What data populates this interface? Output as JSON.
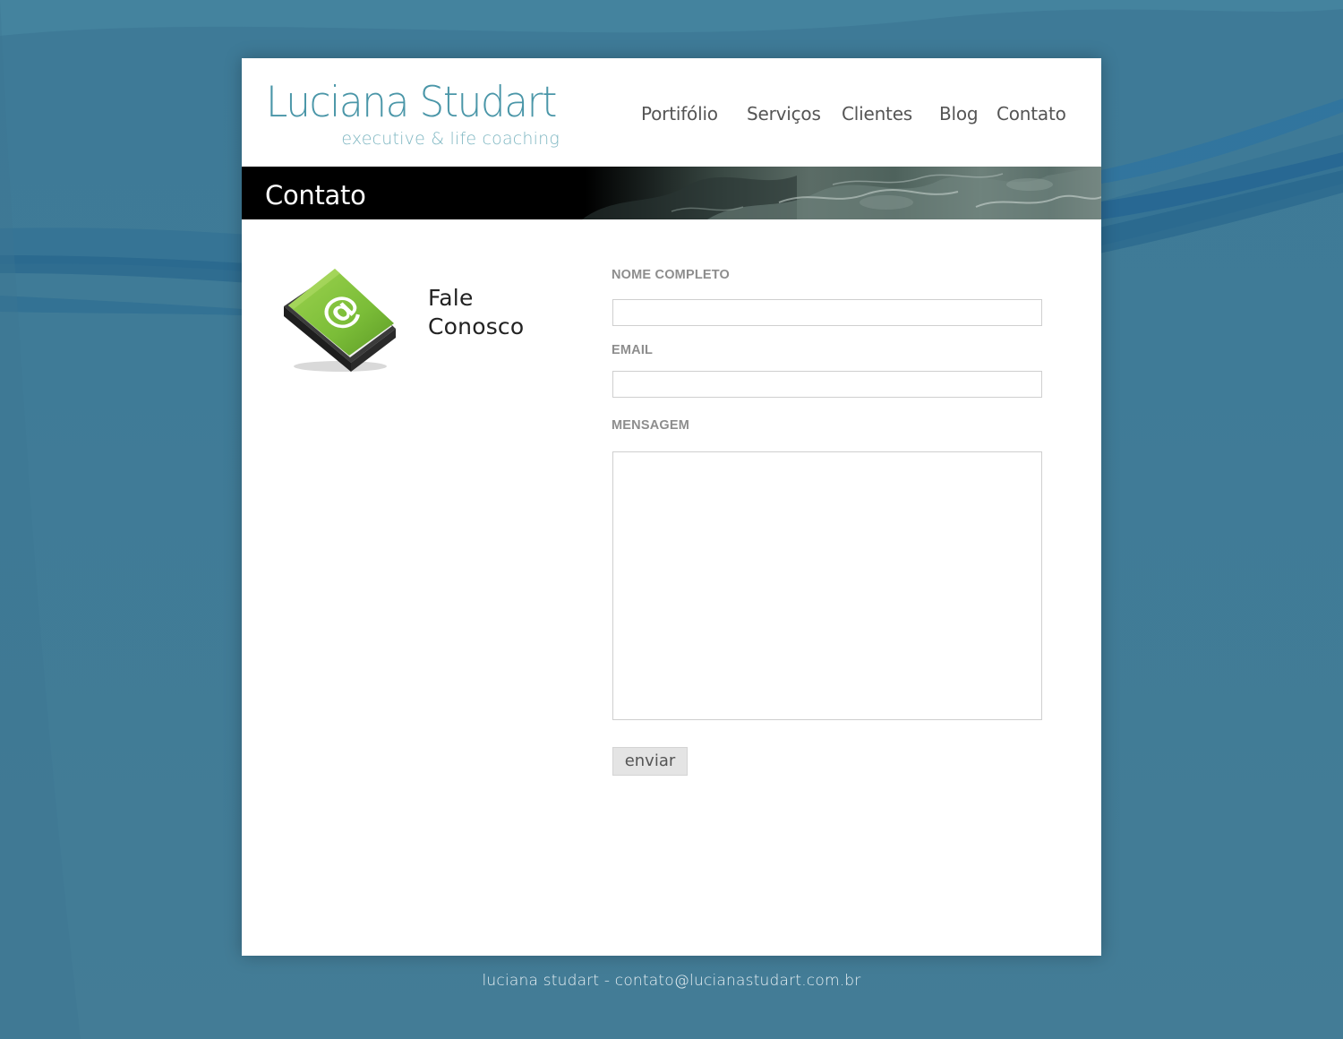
{
  "colors": {
    "background": "#417a96",
    "logo_title": "#4a96a8",
    "logo_subtitle": "#7fb7c2",
    "nav_text": "#555555",
    "banner_bg": "#000000",
    "book_green": "#7dc142",
    "label_gray": "#8d8d8d",
    "footer_text": "#e6eff3"
  },
  "header": {
    "logo_title": "Luciana Studart",
    "logo_subtitle": "executive & life coaching"
  },
  "nav": {
    "items": [
      {
        "label": "Portifólio",
        "icon": null
      },
      {
        "label": "Serviços",
        "icon": null
      },
      {
        "label": "Clientes",
        "icon": null
      },
      {
        "label": "Blog",
        "icon": null
      },
      {
        "label": "Contato",
        "icon": null
      }
    ]
  },
  "banner": {
    "title": "Contato"
  },
  "sidebar": {
    "icon": "email-book-icon",
    "heading_line1": "Fale",
    "heading_line2": "Conosco"
  },
  "form": {
    "name_label": "NOME COMPLETO",
    "name_value": "",
    "email_label": "EMAIL",
    "email_value": "",
    "message_label": "MENSAGEM",
    "message_value": "",
    "submit_label": "enviar"
  },
  "footer": {
    "text": "luciana studart - contato@lucianastudart.com.br"
  }
}
